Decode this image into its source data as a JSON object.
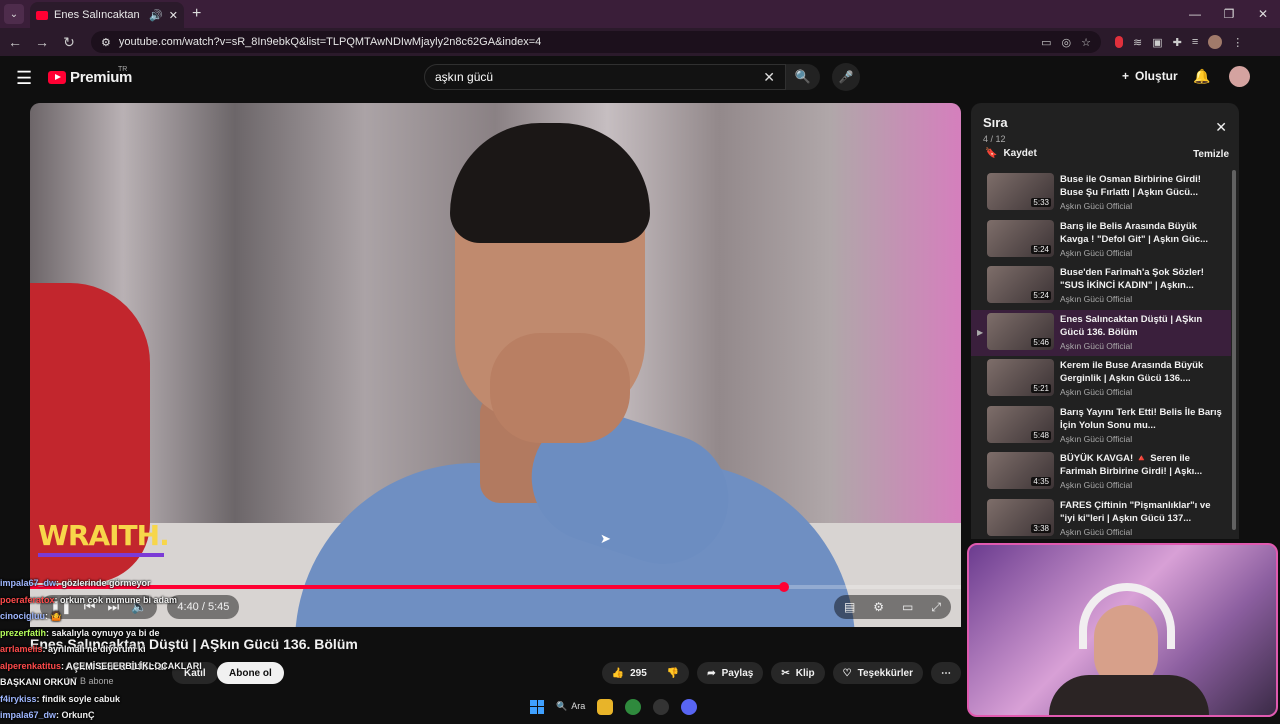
{
  "browser": {
    "tab_title": "Enes Salıncaktan Düştü | AŞ",
    "url": "youtube.com/watch?v=sR_8In9ebkQ&list=TLPQMTAwNDIwMjayly2n8c62GA&index=4"
  },
  "header": {
    "logo": "Premium",
    "region": "TR",
    "search_query": "aşkın gücü",
    "create_label": "Oluştur"
  },
  "player": {
    "overlay_brand": "WRAITH.",
    "time": "4:40 / 5:45",
    "progress_fraction": 0.81
  },
  "video": {
    "title": "Enes Salıncaktan Düştü | AŞkın Gücü 136. Bölüm",
    "channel": "Aşkın Gücü Official",
    "subscribers": "1,7 B abone",
    "join_label": "Katıl",
    "subscribe_label": "Abone ol",
    "likes": "295",
    "share_label": "Paylaş",
    "clip_label": "Klip",
    "thanks_label": "Teşekkürler"
  },
  "queue": {
    "title": "Sıra",
    "count": "4 / 12",
    "save_label": "Kaydet",
    "clear_label": "Temizle",
    "items": [
      {
        "title": "Buse ile Osman Birbirine Girdi! Buse Şu Fırlattı | Aşkın Gücü...",
        "channel": "Aşkın Gücü Official",
        "duration": "5:33"
      },
      {
        "title": "Barış ile Belis Arasında Büyük Kavga ! \"Defol Git\" | Aşkın Güc...",
        "channel": "Aşkın Gücü Official",
        "duration": "5:24"
      },
      {
        "title": "Buse'den Farimah'a Şok Sözler! \"SUS İKİNCİ KADIN\" | Aşkın...",
        "channel": "Aşkın Gücü Official",
        "duration": "5:24"
      },
      {
        "title": "Enes Salıncaktan Düştü | AŞkın Gücü 136. Bölüm",
        "channel": "Aşkın Gücü Official",
        "duration": "5:46"
      },
      {
        "title": "Kerem ile Buse Arasında Büyük Gerginlik | Aşkın Gücü 136....",
        "channel": "Aşkın Gücü Official",
        "duration": "5:21"
      },
      {
        "title": "Barış Yayını Terk Etti! Belis İle Barış İçin Yolun Sonu mu...",
        "channel": "Aşkın Gücü Official",
        "duration": "5:48"
      },
      {
        "title": "BÜYÜK KAVGA! 🔺 Seren ile Farimah Birbirine Girdi! | Aşkı...",
        "channel": "Aşkın Gücü Official",
        "duration": "4:35"
      },
      {
        "title": "FARES Çiftinin \"Pişmanlıklar\"ı ve \"iyi ki\"leri | Aşkın Gücü 137...",
        "channel": "Aşkın Gücü Official",
        "duration": "3:38"
      }
    ]
  },
  "chat": [
    {
      "user": "impala67_dw",
      "text": ": gözlerinde görmeyor"
    },
    {
      "user": "poeraferatox",
      "text": ": orkun cok numune bi adam"
    },
    {
      "user": "cinocigluu",
      "text": ": 🤷"
    },
    {
      "user": "prezerfatih",
      "text": ": sakalıyla oynuyo ya bi de"
    },
    {
      "user": "arrlamelis",
      "text": ": ayrılmalı ne diyorum ki"
    },
    {
      "user": "alperenkatitus",
      "text": ": ACEMİSEFERBİLİKLOCAKLARI"
    },
    {
      "user": "",
      "text": "BAŞKANI ORKUN"
    },
    {
      "user": "f4irykiss",
      "text": ": findik soyle cabuk"
    },
    {
      "user": "impala67_dw",
      "text": ": OrkunÇ"
    }
  ],
  "taskbar": {
    "search_label": "Ara"
  }
}
